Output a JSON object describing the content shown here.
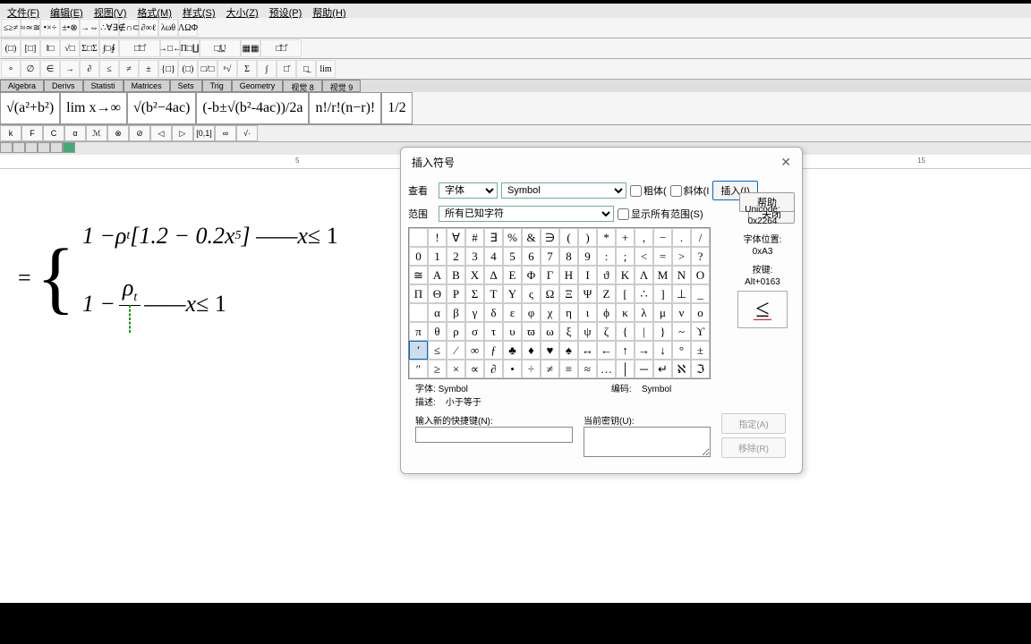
{
  "menu": [
    "文件(F)",
    "编辑(E)",
    "视图(V)",
    "格式(M)",
    "样式(S)",
    "大小(Z)",
    "预设(P)",
    "帮助(H)"
  ],
  "toolbar_groups": [
    [
      "≤≥≠",
      "≈≃≅",
      "•×÷",
      "±•⊗",
      "→⇔",
      "∴∀∃",
      "∉∩⊂",
      "∂∞ℓ",
      "λωθ",
      "ΛΩΦ"
    ],
    [
      "(□)",
      "[□]",
      "‖□",
      "√□",
      "Σ□Σ",
      "∫□∮",
      "□̄□̂",
      "→□←",
      "Π□∐",
      "□̲U̲",
      "▦▦",
      "□̌□̂"
    ],
    [
      "∘",
      "∅",
      "∈",
      "→",
      "∂",
      "≤",
      "≠",
      "±",
      "{□}",
      "(□)",
      "□/□",
      "ⁿ√",
      "Σ",
      "∫",
      "□̄",
      "□̲",
      "lim"
    ]
  ],
  "tabs": [
    "Algebra",
    "Derivs",
    "Statisti",
    "Matrices",
    "Sets",
    "Trig",
    "Geometry",
    "视觉 8",
    "视觉 9"
  ],
  "templates": [
    "√(a²+b²)",
    "lim x→∞",
    "√(b²−4ac)",
    "(-b±√(b²-4ac))/2a",
    "n!/r!(n−r)!",
    "1/2"
  ],
  "tiny_buttons": [
    "k",
    "F",
    "C",
    "α",
    "ℳ",
    "⊗",
    "⊘",
    "◁",
    "▷",
    "[0,1]",
    "∞",
    "√·"
  ],
  "ruler_marks": [
    {
      "pos": 330,
      "label": "5"
    },
    {
      "pos": 1025,
      "label": "15"
    }
  ],
  "equation": {
    "eq_sign": "=",
    "line1_parts": [
      "1 − ",
      "ρ",
      "t",
      "[1.2 − 0.2",
      "x",
      "5",
      "] —— ",
      "x",
      " ≤ 1"
    ],
    "line2_parts": [
      "1 − ",
      "ρ",
      "t",
      " —— ",
      "x",
      " ≤ 1"
    ]
  },
  "dialog": {
    "title": "插入符号",
    "look_label": "查看",
    "font_label": "字体",
    "font_value": "Symbol",
    "bold_label": "粗体(",
    "italic_label": "斜体(I",
    "insert_btn": "插入(I)",
    "range_label": "范围",
    "range_value": "所有已知字符",
    "show_all_label": "显示所有范围(S)",
    "close_btn": "关闭",
    "help_btn": "帮助",
    "unicode_label": "Unicode:",
    "unicode_value": "0x2264",
    "fontpos_label": "字体位置:",
    "fontpos_value": "0xA3",
    "keystroke_label": "按键:",
    "keystroke_value": "Alt+0163",
    "preview_symbol": "≤",
    "font_info_label": "字体:",
    "font_info_value": "Symbol",
    "encoding_label": "编码:",
    "encoding_value": "Symbol",
    "desc_label": "描述:",
    "desc_value": "小于等于",
    "new_shortcut_label": "输入新的快捷键(N):",
    "current_key_label": "当前密钥(U):",
    "assign_btn": "指定(A)",
    "remove_btn": "移除(R)",
    "selected_index": 96,
    "symbols": [
      " ",
      "!",
      "∀",
      "#",
      "∃",
      "%",
      "&",
      "∋",
      "(",
      ")",
      "*",
      "+",
      ",",
      "−",
      ".",
      "/",
      "0",
      "1",
      "2",
      "3",
      "4",
      "5",
      "6",
      "7",
      "8",
      "9",
      ":",
      ";",
      "<",
      "=",
      ">",
      "?",
      "≅",
      "Α",
      "Β",
      "Χ",
      "Δ",
      "Ε",
      "Φ",
      "Γ",
      "Η",
      "Ι",
      "ϑ",
      "Κ",
      "Λ",
      "Μ",
      "Ν",
      "Ο",
      "Π",
      "Θ",
      "Ρ",
      "Σ",
      "Τ",
      "Υ",
      "ς",
      "Ω",
      "Ξ",
      "Ψ",
      "Ζ",
      "[",
      "∴",
      "]",
      "⊥",
      "_",
      " ",
      "α",
      "β",
      "γ",
      "δ",
      "ε",
      "φ",
      "χ",
      "η",
      "ι",
      "ϕ",
      "κ",
      "λ",
      "μ",
      "ν",
      "ο",
      "π",
      "θ",
      "ρ",
      "σ",
      "τ",
      "υ",
      "ϖ",
      "ω",
      "ξ",
      "ψ",
      "ζ",
      "{",
      "|",
      "}",
      "~",
      "ϒ",
      "′",
      "≤",
      "⁄",
      "∞",
      "ƒ",
      "♣",
      "♦",
      "♥",
      "♠",
      "↔",
      "←",
      "↑",
      "→",
      "↓",
      "°",
      "±",
      "″",
      "≥",
      "×",
      "∝",
      "∂",
      "•",
      "÷",
      "≠",
      "≡",
      "≈",
      "…",
      "│",
      "─",
      "↵",
      "ℵ",
      "ℑ"
    ]
  }
}
